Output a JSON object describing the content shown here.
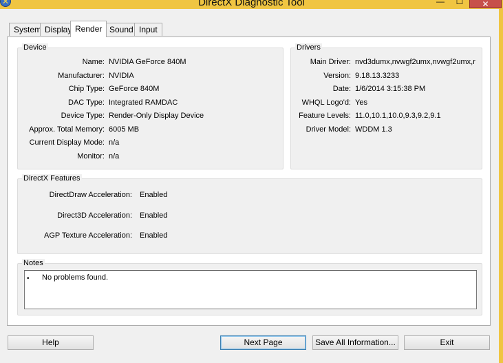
{
  "window": {
    "title": "DirectX Diagnostic Tool",
    "minimize_glyph": "—",
    "maximize_glyph": "☐",
    "close_glyph": "✕"
  },
  "tabs": [
    {
      "label": "System"
    },
    {
      "label": "Display"
    },
    {
      "label": "Render"
    },
    {
      "label": "Sound"
    },
    {
      "label": "Input"
    }
  ],
  "active_tab": "Render",
  "device": {
    "title": "Device",
    "rows": [
      {
        "label": "Name:",
        "value": "NVIDIA GeForce 840M"
      },
      {
        "label": "Manufacturer:",
        "value": "NVIDIA"
      },
      {
        "label": "Chip Type:",
        "value": "GeForce 840M"
      },
      {
        "label": "DAC Type:",
        "value": "Integrated RAMDAC"
      },
      {
        "label": "Device Type:",
        "value": "Render-Only Display Device"
      },
      {
        "label": "Approx. Total Memory:",
        "value": "6005 MB"
      },
      {
        "label": "Current Display Mode:",
        "value": "n/a"
      },
      {
        "label": "Monitor:",
        "value": "n/a"
      }
    ]
  },
  "drivers": {
    "title": "Drivers",
    "rows": [
      {
        "label": "Main Driver:",
        "value": "nvd3dumx,nvwgf2umx,nvwgf2umx,r"
      },
      {
        "label": "Version:",
        "value": "9.18.13.3233"
      },
      {
        "label": "Date:",
        "value": "1/6/2014 3:15:38 PM"
      },
      {
        "label": "WHQL Logo'd:",
        "value": "Yes"
      },
      {
        "label": "Feature Levels:",
        "value": "11.0,10.1,10.0,9.3,9.2,9.1"
      },
      {
        "label": "Driver Model:",
        "value": "WDDM 1.3"
      }
    ]
  },
  "features": {
    "title": "DirectX Features",
    "rows": [
      {
        "label": "DirectDraw Acceleration:",
        "value": "Enabled"
      },
      {
        "label": "Direct3D Acceleration:",
        "value": "Enabled"
      },
      {
        "label": "AGP Texture Acceleration:",
        "value": "Enabled"
      }
    ]
  },
  "notes": {
    "title": "Notes",
    "bullet": "•",
    "items": [
      "No problems found."
    ]
  },
  "buttons": {
    "help": "Help",
    "next_page": "Next Page",
    "save_all": "Save All Information...",
    "exit": "Exit"
  },
  "icons": {
    "app": "directx-icon"
  },
  "colors": {
    "titlebar": "#f0c542",
    "close_button": "#c7504b",
    "default_button_border": "#3c7fb1"
  }
}
